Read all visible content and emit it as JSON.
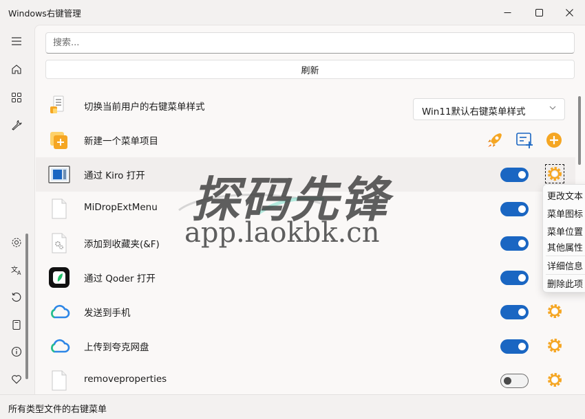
{
  "window": {
    "title": "Windows右键管理"
  },
  "search": {
    "placeholder": "搜索..."
  },
  "toolbar": {
    "refresh_label": "刷新"
  },
  "rows": [
    {
      "label": "切换当前用户的右键菜单样式",
      "control": "select",
      "selected": "Win11默认右键菜单样式"
    },
    {
      "label": "新建一个菜单项目",
      "control": "actions"
    },
    {
      "label": "通过 Kiro 打开",
      "enabled": true
    },
    {
      "label": "MiDropExtMenu",
      "enabled": true
    },
    {
      "label": "添加到收藏夹(&F)",
      "enabled": true
    },
    {
      "label": "通过 Qoder 打开",
      "enabled": true
    },
    {
      "label": "发送到手机",
      "enabled": true
    },
    {
      "label": "上传到夸克网盘",
      "enabled": true
    },
    {
      "label": "removeproperties",
      "enabled": false
    }
  ],
  "context_menu": {
    "items": [
      "更改文本",
      "菜单图标",
      "菜单位置",
      "其他属性",
      "详细信息",
      "删除此项"
    ]
  },
  "watermark": {
    "cn": "探码先锋",
    "url": "app.laokbk.cn"
  },
  "status": {
    "text": "所有类型文件的右键菜单"
  },
  "colors": {
    "accent": "#1a66c2",
    "gear": "#f5a623"
  }
}
